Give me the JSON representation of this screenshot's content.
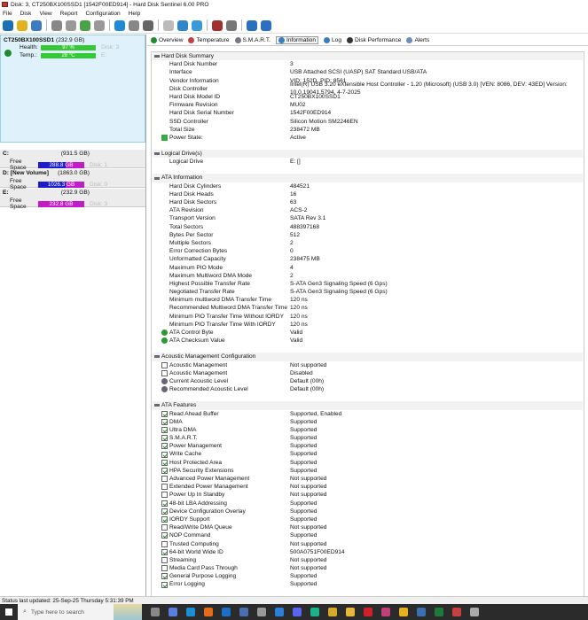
{
  "window": {
    "title": "Disk: 3, CT250BX100SSD1 [1542F00ED914]  -  Hard Disk Sentinel 6.00 PRO"
  },
  "menu": [
    "File",
    "Disk",
    "View",
    "Report",
    "Configuration",
    "Help"
  ],
  "toolbar": {
    "icons": [
      "refresh-icon",
      "alert-icon",
      "report-icon",
      "disk-icon",
      "disk-test-icon",
      "disk-check-icon",
      "disk-tool-icon",
      "globe-icon",
      "satellite-icon",
      "print-icon",
      "document-icon",
      "sync-icon",
      "network-icon",
      "chart-icon",
      "settings-icon",
      "help-icon",
      "info-icon"
    ],
    "colors": [
      "#1a6fb5",
      "#e3b21d",
      "#3a7cc1",
      "#888",
      "#999",
      "#4aa14a",
      "#999",
      "#1d8ad6",
      "#888",
      "#666",
      "#bbb",
      "#2f86c9",
      "#3a9ad8",
      "#a03030",
      "#777",
      "#2a6fc0",
      "#2a6fc0"
    ]
  },
  "disk": {
    "name": "CT250BX100SSD1",
    "size": "(232.9 GB)",
    "health_label": "Health:",
    "health": "97 %",
    "health_percent": 97,
    "disk_no": "Disk: 3",
    "temp_label": "Temp.:",
    "temp": "28 °C",
    "drive": "E:"
  },
  "drives": [
    {
      "name": "C:",
      "size": "(931.5 GB)",
      "label": "Free Space",
      "free": "288.8 GB",
      "disk": "Disk: 1",
      "color": "#1b1bd0"
    },
    {
      "name": "D: [New Volume]",
      "size": "(1863.0 GB)",
      "label": "Free Space",
      "free": "1026.3 GB",
      "disk": "Disk: 0",
      "color": "#1b1bd0"
    },
    {
      "name": "E:",
      "size": "(232.9 GB)",
      "label": "Free Space",
      "free": "232.8 GB",
      "disk": "Disk: 3",
      "color": "#c21bc8"
    }
  ],
  "tabs": [
    {
      "label": "Overview",
      "color": "#1e8c2e"
    },
    {
      "label": "Temperature",
      "color": "#b44"
    },
    {
      "label": "S.M.A.R.T.",
      "color": "#778"
    },
    {
      "label": "Information",
      "color": "#3a7cc1",
      "active": true
    },
    {
      "label": "Log",
      "color": "#3a7cc1"
    },
    {
      "label": "Disk Performance",
      "color": "#333"
    },
    {
      "label": "Alerts",
      "color": "#6a8fc0"
    }
  ],
  "sections": [
    {
      "title": "Hard Disk Summary",
      "icon": "disk",
      "rows": [
        [
          "none",
          "Hard Disk Number",
          "3"
        ],
        [
          "none",
          "Interface",
          "USB Attached SCSI (UASP) SAT Standard USB/ATA"
        ],
        [
          "none",
          "Vendor Information",
          "VID: 152D, PID: 8561"
        ],
        [
          "none",
          "Disk Controller",
          "Intel(R) USB 3.20 eXtensible Host Controller - 1.20 (Microsoft) (USB 3.0) [VEN: 8086, DEV: 43ED] Version: 10.0.19041.5794, 4-7-2025"
        ],
        [
          "none",
          "Hard Disk Model ID",
          "CT250BX100SSD1"
        ],
        [
          "none",
          "Firmware Revision",
          "MU02"
        ],
        [
          "none",
          "Hard Disk Serial Number",
          "1542F00ED914"
        ],
        [
          "none",
          "SSD Controller",
          "Silicon Motion SM2246EN"
        ],
        [
          "none",
          "Total Size",
          "238472 MB"
        ],
        [
          "power",
          "Power State:",
          "Active"
        ]
      ]
    },
    {
      "title": "Logical Drive(s)",
      "icon": "disk",
      "rows": [
        [
          "none",
          "Logical Drive",
          "E: []"
        ]
      ]
    },
    {
      "title": "ATA Information",
      "icon": "disk",
      "rows": [
        [
          "none",
          "Hard Disk Cylinders",
          "484521"
        ],
        [
          "none",
          "Hard Disk Heads",
          "16"
        ],
        [
          "none",
          "Hard Disk Sectors",
          "63"
        ],
        [
          "none",
          "ATA Revision",
          "ACS-2"
        ],
        [
          "none",
          "Transport Version",
          "SATA Rev 3.1"
        ],
        [
          "none",
          "Total Sectors",
          "488397168"
        ],
        [
          "none",
          "Bytes Per Sector",
          "512"
        ],
        [
          "none",
          "Multiple Sectors",
          "2"
        ],
        [
          "none",
          "Error Correction Bytes",
          "0"
        ],
        [
          "none",
          "Unformatted Capacity",
          "238475 MB"
        ],
        [
          "none",
          "Maximum PIO Mode",
          "4"
        ],
        [
          "none",
          "Maximum Multiword DMA Mode",
          "2"
        ],
        [
          "none",
          "Highest Possible Transfer Rate",
          "S-ATA Gen3 Signaling Speed (6 Gps)"
        ],
        [
          "none",
          "Negotiated Transfer Rate",
          "S-ATA Gen3 Signaling Speed (6 Gps)"
        ],
        [
          "none",
          "Minimum multiword DMA Transfer Time",
          "120 ns"
        ],
        [
          "none",
          "Recommended Multiword DMA Transfer Time",
          "120 ns"
        ],
        [
          "none",
          "Minimum PIO Transfer Time Without IORDY",
          "120 ns"
        ],
        [
          "none",
          "Minimum PIO Transfer Time With IORDY",
          "120 ns"
        ],
        [
          "check-circle",
          "ATA Control Byte",
          "Valid"
        ],
        [
          "check-circle",
          "ATA Checksum Value",
          "Valid"
        ]
      ]
    },
    {
      "title": "Acoustic Management Configuration",
      "icon": "speaker",
      "rows": [
        [
          "checkbox-empty",
          "Acoustic Management",
          "Not supported"
        ],
        [
          "checkbox-empty",
          "Acoustic Management",
          "Disabled"
        ],
        [
          "speaker",
          "Current Acoustic Level",
          "Default (00h)"
        ],
        [
          "speaker",
          "Recommended Acoustic Level",
          "Default (00h)"
        ]
      ]
    },
    {
      "title": "ATA Features",
      "icon": "disk",
      "rows": [
        [
          "checkbox-checked",
          "Read Ahead Buffer",
          "Supported, Enabled"
        ],
        [
          "checkbox-checked",
          "DMA",
          "Supported"
        ],
        [
          "checkbox-checked",
          "Ultra DMA",
          "Supported"
        ],
        [
          "checkbox-checked",
          "S.M.A.R.T.",
          "Supported"
        ],
        [
          "checkbox-checked",
          "Power Management",
          "Supported"
        ],
        [
          "checkbox-checked",
          "Write Cache",
          "Supported"
        ],
        [
          "checkbox-checked",
          "Host Protected Area",
          "Supported"
        ],
        [
          "checkbox-checked",
          "HPA Security Extensions",
          "Supported"
        ],
        [
          "checkbox-empty",
          "Advanced Power Management",
          "Not supported"
        ],
        [
          "checkbox-empty",
          "Extended Power Management",
          "Not supported"
        ],
        [
          "checkbox-empty",
          "Power Up In Standby",
          "Not supported"
        ],
        [
          "checkbox-checked",
          "48-bit LBA Addressing",
          "Supported"
        ],
        [
          "checkbox-checked",
          "Device Configuration Overlay",
          "Supported"
        ],
        [
          "checkbox-checked",
          "IORDY Support",
          "Supported"
        ],
        [
          "checkbox-empty",
          "Read/Write DMA Queue",
          "Not supported"
        ],
        [
          "checkbox-checked",
          "NOP Command",
          "Supported"
        ],
        [
          "checkbox-empty",
          "Trusted Computing",
          "Not supported"
        ],
        [
          "checkbox-checked",
          "64-bit World Wide ID",
          "500A0751F00ED914"
        ],
        [
          "checkbox-empty",
          "Streaming",
          "Not supported"
        ],
        [
          "checkbox-empty",
          "Media Card Pass Through",
          "Not supported"
        ],
        [
          "checkbox-checked",
          "General Purpose Logging",
          "Supported"
        ],
        [
          "checkbox-checked",
          "Error Logging",
          "Supported"
        ]
      ]
    }
  ],
  "status": "Status last updated: 25-Sep-25 Thursday 5:31:39 PM",
  "taskbar": {
    "search_placeholder": "Type here to search",
    "apps": [
      "task-view",
      "copilot",
      "edge",
      "firefox",
      "outlook",
      "app-blue",
      "app-tool",
      "app-photo",
      "discord",
      "app-green",
      "store",
      "file-explorer",
      "opera",
      "app-paint",
      "chrome",
      "app-python",
      "excel",
      "hard-disk-sentinel",
      "app-misc"
    ],
    "colors": [
      "#888",
      "#5a7de0",
      "#1a8fd6",
      "#e66a1a",
      "#1a6fc6",
      "#4a6fb0",
      "#999",
      "#2a7fd9",
      "#5865f2",
      "#1bb38c",
      "#d8a82a",
      "#e6b73a",
      "#d0202a",
      "#c0407a",
      "#e8b020",
      "#3a70b0",
      "#1d7a3c",
      "#c84040",
      "#aaa"
    ]
  }
}
